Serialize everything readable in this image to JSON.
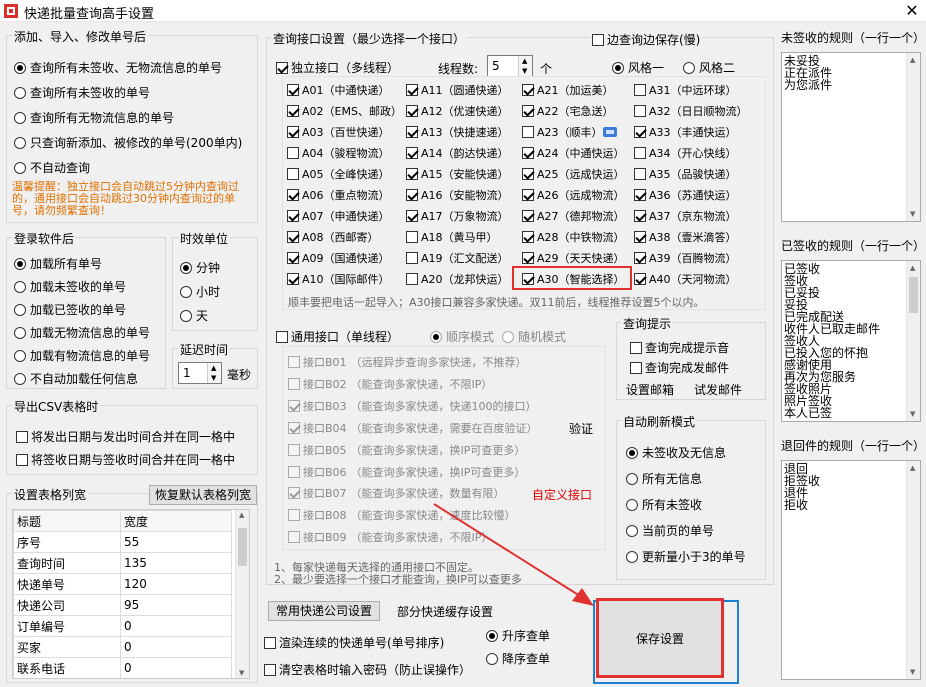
{
  "window": {
    "title": "快递批量查询高手设置",
    "close": "✕"
  },
  "left": {
    "add_group": {
      "title": "添加、导入、修改单号后",
      "options": [
        "查询所有未签收、无物流信息的单号",
        "查询所有未签收的单号",
        "查询所有无物流信息的单号",
        "只查询新添加、被修改的单号(200单内)",
        "不自动查询"
      ],
      "selected": 0,
      "tip": "温馨提醒：独立接口会自动跳过5分钟内查询过的，通用接口会自动跳过30分钟内查询过的单号，请勿频繁查询！"
    },
    "login_group": {
      "title": "登录软件后",
      "options": [
        "加载所有单号",
        "加载未签收的单号",
        "加载已签收的单号",
        "加载无物流信息的单号",
        "加载有物流信息的单号",
        "不自动加载任何信息"
      ],
      "selected": 0
    },
    "time_unit": {
      "title": "时效单位",
      "options": [
        "分钟",
        "小时",
        "天"
      ],
      "selected": 0
    },
    "delay": {
      "title": "延迟时间",
      "value": "1",
      "unit": "毫秒"
    },
    "csv_group": {
      "title": "导出CSV表格时",
      "options": [
        "将发出日期与发出时间合并在同一格中",
        "将签收日期与签收时间合并在同一格中"
      ]
    },
    "col_width": {
      "title": "设置表格列宽",
      "reset_button": "恢复默认表格列宽",
      "headers": [
        "标题",
        "宽度"
      ],
      "rows": [
        [
          "序号",
          "55"
        ],
        [
          "查询时间",
          "135"
        ],
        [
          "快递单号",
          "120"
        ],
        [
          "快递公司",
          "95"
        ],
        [
          "订单编号",
          "0"
        ],
        [
          "买家",
          "0"
        ],
        [
          "联系电话",
          "0"
        ]
      ]
    }
  },
  "query": {
    "title": "查询接口设置（最少选择一个接口）",
    "save_while": "边查询边保存(慢)",
    "independent": {
      "label": "独立接口（多线程）",
      "threads_label": "线程数:",
      "threads": "5",
      "threads_unit": "个",
      "style_options": [
        "风格一",
        "风格二"
      ],
      "style_selected": 0,
      "apis": [
        {
          "label": "A01（中通快递）",
          "checked": true
        },
        {
          "label": "A11（圆通快递）",
          "checked": true
        },
        {
          "label": "A21（加运美）",
          "checked": true
        },
        {
          "label": "A31（中远环球）",
          "checked": false
        },
        {
          "label": "A02（EMS、邮政）",
          "checked": true
        },
        {
          "label": "A12（优速快递）",
          "checked": true
        },
        {
          "label": "A22（宅急送）",
          "checked": true
        },
        {
          "label": "A32（日日顺物流）",
          "checked": false
        },
        {
          "label": "A03（百世快递）",
          "checked": true
        },
        {
          "label": "A13（快捷速递）",
          "checked": true
        },
        {
          "label": "A23（顺丰）",
          "checked": false
        },
        {
          "label": "A33（丰通快运）",
          "checked": true
        },
        {
          "label": "A04（骏程物流）",
          "checked": false
        },
        {
          "label": "A14（韵达快递）",
          "checked": true
        },
        {
          "label": "A24（中通快运）",
          "checked": true
        },
        {
          "label": "A34（开心快线）",
          "checked": false
        },
        {
          "label": "A05（全峰快递）",
          "checked": false
        },
        {
          "label": "A15（安能快递）",
          "checked": true
        },
        {
          "label": "A25（远成快运）",
          "checked": true
        },
        {
          "label": "A35（品骏快递）",
          "checked": false
        },
        {
          "label": "A06（重点物流）",
          "checked": true
        },
        {
          "label": "A16（安能物流）",
          "checked": true
        },
        {
          "label": "A26（远成物流）",
          "checked": true
        },
        {
          "label": "A36（苏通快运）",
          "checked": true
        },
        {
          "label": "A07（申通快递）",
          "checked": true
        },
        {
          "label": "A17（万象物流）",
          "checked": true
        },
        {
          "label": "A27（德邦物流）",
          "checked": true
        },
        {
          "label": "A37（京东物流）",
          "checked": true
        },
        {
          "label": "A08（西邮寄）",
          "checked": true
        },
        {
          "label": "A18（黄马甲）",
          "checked": false
        },
        {
          "label": "A28（中铁物流）",
          "checked": true
        },
        {
          "label": "A38（壹米滴答）",
          "checked": true
        },
        {
          "label": "A09（国通快递）",
          "checked": true
        },
        {
          "label": "A19（汇文配送）",
          "checked": false
        },
        {
          "label": "A29（天天快递）",
          "checked": true
        },
        {
          "label": "A39（百腾物流）",
          "checked": true
        },
        {
          "label": "A10（国际邮件）",
          "checked": true
        },
        {
          "label": "A20（龙邦快运）",
          "checked": false
        },
        {
          "label": "A30（智能选择）",
          "checked": true
        },
        {
          "label": "A40（天河物流）",
          "checked": true
        }
      ],
      "note": "顺丰要把电话一起导入；A30接口兼容多家快递。双11前后，线程推荐设置5个以内。"
    },
    "general": {
      "label": "通用接口（单线程）",
      "mode_options": [
        "顺序模式",
        "随机模式"
      ],
      "apis": [
        {
          "label": "接口B01",
          "desc": "（远程异步查询多家快递，不推荐）",
          "checked": false
        },
        {
          "label": "接口B02",
          "desc": "（能查询多家快递，不限IP）",
          "checked": false
        },
        {
          "label": "接口B03",
          "desc": "（能查询多家快递，快递100的接口）",
          "checked": true
        },
        {
          "label": "接口B04",
          "desc": "（能查询多家快递，需要在百度验证）",
          "checked": true
        },
        {
          "label": "接口B05",
          "desc": "（能查询多家快递，换IP可查更多）",
          "checked": false
        },
        {
          "label": "接口B06",
          "desc": "（能查询多家快递，换IP可查更多）",
          "checked": false
        },
        {
          "label": "接口B07",
          "desc": "（能查询多家快递，数量有限）",
          "checked": true
        },
        {
          "label": "接口B08",
          "desc": "（能查询多家快递，速度比较慢）",
          "checked": false
        },
        {
          "label": "接口B09",
          "desc": "（能查询多家快递，不限IP）",
          "checked": false
        }
      ],
      "verify": "验证",
      "custom": "自定义接口",
      "note1": "1、每家快递每天选择的通用接口不固定。",
      "note2": "2、最少要选择一个接口才能查询，换IP可以查更多"
    }
  },
  "query_tips": {
    "title": "查询提示",
    "options": [
      "查询完成提示音",
      "查询完成发邮件"
    ],
    "setup_mail": "设置邮箱",
    "test_mail": "试发邮件"
  },
  "auto_refresh": {
    "title": "自动刷新模式",
    "options": [
      "未签收及无信息",
      "所有无信息",
      "所有未签收",
      "当前页的单号",
      "更新量小于3的单号"
    ],
    "selected": 0
  },
  "bottom": {
    "common_button": "常用快递公司设置",
    "cache_label": "部分快递缓存设置",
    "render_continuous": "渲染连续的快递单号(单号排序)",
    "clear_password": "清空表格时输入密码（防止误操作）",
    "sort_options": [
      "升序查单",
      "降序查单"
    ],
    "sort_selected": 0,
    "save_button": "保存设置"
  },
  "rules": {
    "unsigned": {
      "title": "未签收的规则（一行一个）",
      "lines": [
        "未妥投",
        "正在派件",
        "为您派件"
      ]
    },
    "signed": {
      "title": "已签收的规则（一行一个）",
      "lines": [
        "已签收",
        "签收",
        "已妥投",
        "妥投",
        "已完成配送",
        "收件人已取走邮件",
        "签收人",
        "已投入您的怀抱",
        "感谢使用",
        "再次为您服务",
        "签收照片",
        "照片签收",
        "本人已签"
      ]
    },
    "returned": {
      "title": "退回件的规则（一行一个）",
      "lines": [
        "退回",
        "拒签收",
        "退件",
        "拒收"
      ]
    }
  },
  "colors": {
    "highlight_red": "#e03030",
    "blue_frame": "#1e7fd6",
    "warn_orange": "#e07000",
    "custom_red": "#e00000"
  }
}
